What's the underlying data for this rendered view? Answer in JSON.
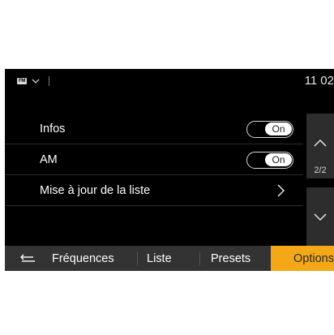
{
  "status": {
    "source_icon_label": "FM",
    "source_chevron_icon": "chevron-down-icon",
    "clock": "11 02"
  },
  "options_list": [
    {
      "label": "Infos",
      "control": "toggle",
      "toggle_value": "On"
    },
    {
      "label": "AM",
      "control": "toggle",
      "toggle_value": "On"
    },
    {
      "label": "Mise à jour de la liste",
      "control": "chevron",
      "icon": "chevron-right-icon"
    }
  ],
  "scroll": {
    "up_icon": "chevron-up-icon",
    "down_icon": "chevron-down-icon",
    "page_indicator": "2/2"
  },
  "tabs": {
    "back_icon": "back-arrow-icon",
    "items": [
      {
        "label": "Fréquences"
      },
      {
        "label": "Liste"
      },
      {
        "label": "Presets"
      },
      {
        "label": "Options",
        "active": true
      }
    ]
  },
  "colors": {
    "background": "#000000",
    "panel": "#2d2d2d",
    "tab_bar": "#333333",
    "active_tab": "#f4a817",
    "text": "#ffffff"
  }
}
